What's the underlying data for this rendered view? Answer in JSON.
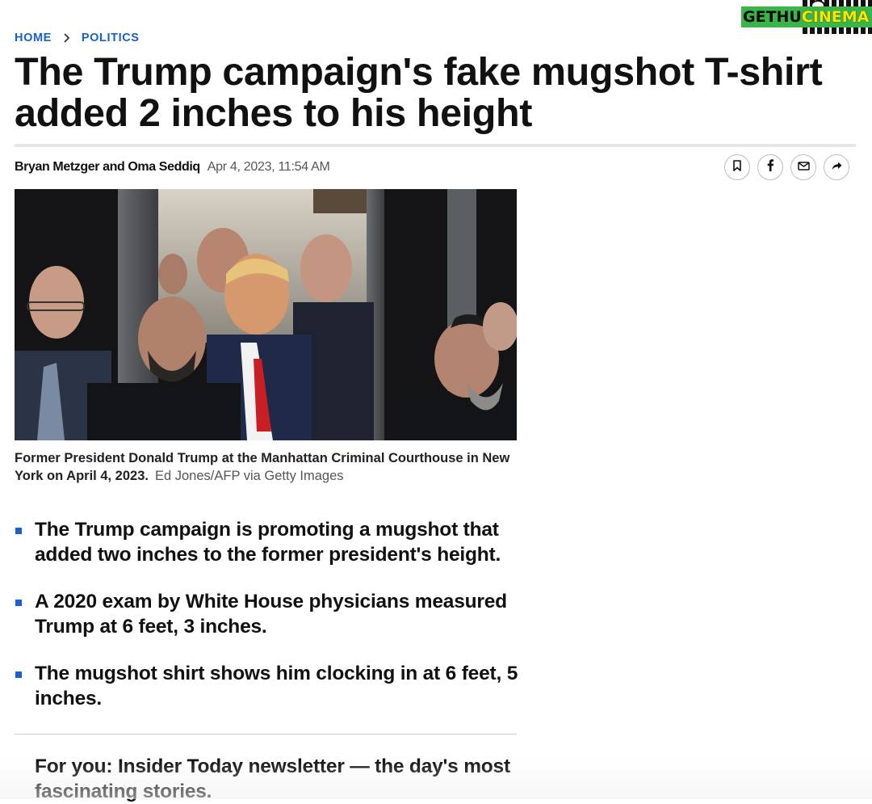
{
  "watermark": {
    "text_part1": "GETHU",
    "text_part2": "CINEMA",
    "bg_color": "#3ab54a",
    "accent_color": "#ffe600"
  },
  "breadcrumb": {
    "items": [
      {
        "label": "HOME"
      },
      {
        "label": "POLITICS"
      }
    ],
    "separator_icon": "chevron-right-icon"
  },
  "article": {
    "headline": "The Trump campaign's fake mugshot T-shirt added 2 inches to his height",
    "authors": "Bryan Metzger and Oma Seddiq",
    "date": "Apr 4, 2023, 11:54 AM",
    "share_buttons": [
      {
        "icon": "bookmark-icon"
      },
      {
        "icon": "facebook-icon"
      },
      {
        "icon": "email-icon"
      },
      {
        "icon": "share-arrow-icon"
      }
    ],
    "image": {
      "caption": "Former President Donald Trump at the Manhattan Criminal Courthouse in New York on April 4, 2023.",
      "credit": "Ed Jones/AFP via Getty Images"
    },
    "key_points": [
      "The Trump campaign is promoting a mugshot that added two inches to the former president's height.",
      "A 2020 exam by White House physicians measured Trump at 6 feet, 3 inches.",
      "The mugshot shirt shows him clocking in at 6 feet, 5 inches."
    ],
    "promo": "For you: Insider Today newsletter — the day's most fascinating stories."
  },
  "colors": {
    "link_blue": "#1a5fd0",
    "text": "#111111",
    "muted": "#555555"
  }
}
